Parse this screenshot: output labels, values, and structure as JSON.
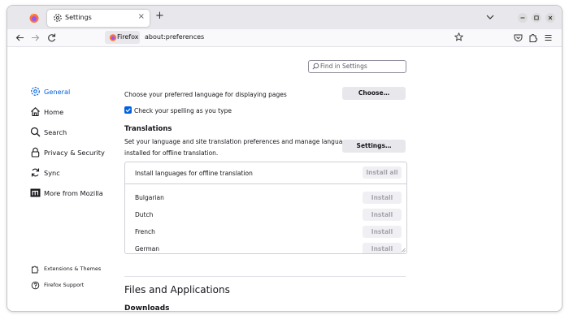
{
  "tab": {
    "title": "Settings",
    "close": "×",
    "new_tab": "+"
  },
  "navbar": {
    "identity_label": "Firefox",
    "url": "about:preferences"
  },
  "search": {
    "placeholder": "Find in Settings"
  },
  "sidebar": {
    "items": [
      {
        "label": "General",
        "icon": "gear-icon",
        "selected": true
      },
      {
        "label": "Home",
        "icon": "home-icon"
      },
      {
        "label": "Search",
        "icon": "search-icon"
      },
      {
        "label": "Privacy & Security",
        "icon": "lock-icon"
      },
      {
        "label": "Sync",
        "icon": "sync-icon"
      },
      {
        "label": "More from Mozilla",
        "icon": "mozilla-icon"
      }
    ],
    "footer": [
      {
        "label": "Extensions & Themes",
        "icon": "puzzle-icon"
      },
      {
        "label": "Firefox Support",
        "icon": "help-icon"
      }
    ]
  },
  "language": {
    "choose_text": "Choose your preferred language for displaying pages",
    "choose_button": "Choose…",
    "spell_check_label": "Check your spelling as you type",
    "spell_check_checked": true
  },
  "translations": {
    "heading": "Translations",
    "description_line1": "Set your language and site translation preferences and manage languages",
    "description_line2": "installed for offline translation.",
    "settings_button": "Settings…",
    "install_header": "Install languages for offline translation",
    "install_all": "Install all",
    "languages": [
      {
        "name": "Bulgarian",
        "action": "Install"
      },
      {
        "name": "Dutch",
        "action": "Install"
      },
      {
        "name": "French",
        "action": "Install"
      },
      {
        "name": "German",
        "action": "Install"
      }
    ]
  },
  "files_apps": {
    "heading": "Files and Applications",
    "next_heading": "Downloads"
  },
  "colors": {
    "accent": "#0061e0",
    "tabstrip": "#e8e8ec",
    "firefox_orange": "#ff7139"
  }
}
